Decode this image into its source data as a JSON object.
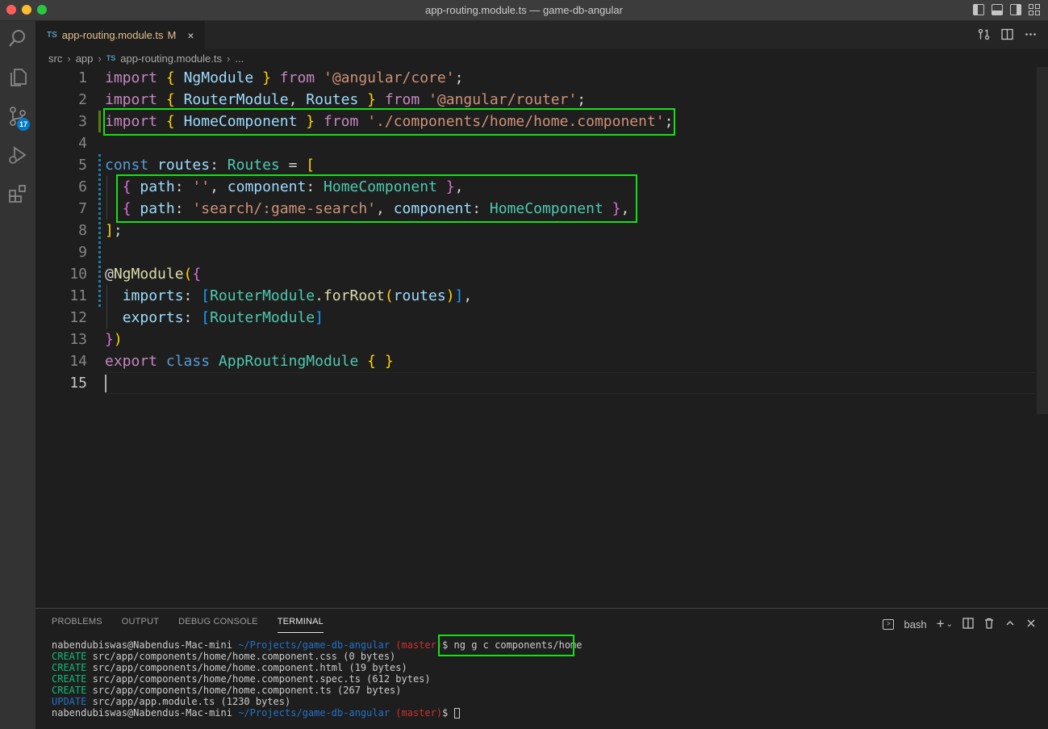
{
  "window": {
    "title": "app-routing.module.ts — game-db-angular"
  },
  "activity_bar": {
    "items": [
      {
        "name": "explorer-search",
        "icon": "search-icon"
      },
      {
        "name": "explorer",
        "icon": "files-icon"
      },
      {
        "name": "source-control",
        "icon": "source-control-icon",
        "badge": "17"
      },
      {
        "name": "run-debug",
        "icon": "run-debug-icon"
      },
      {
        "name": "extensions",
        "icon": "extensions-icon"
      }
    ]
  },
  "tabs": [
    {
      "badge": "TS",
      "label": "app-routing.module.ts",
      "modified": "M",
      "close": "×"
    }
  ],
  "breadcrumb": {
    "items": [
      "src",
      "app",
      "app-routing.module.ts",
      "..."
    ],
    "ts_badge": "TS"
  },
  "editor": {
    "line_numbers": [
      "1",
      "2",
      "3",
      "4",
      "5",
      "6",
      "7",
      "8",
      "9",
      "10",
      "11",
      "12",
      "13",
      "14",
      "15"
    ],
    "active_line": "15"
  },
  "panel": {
    "tabs": [
      "PROBLEMS",
      "OUTPUT",
      "DEBUG CONSOLE",
      "TERMINAL"
    ],
    "active_tab": "TERMINAL",
    "shell": "bash"
  },
  "terminal": {
    "prompt_user": "nabendubiswas@Nabendus-Mac-mini",
    "prompt_path": "~/Projects/game-db-angular",
    "prompt_branch": "(master)",
    "prompt_symbol": "$",
    "command": "ng g c components/home",
    "output": [
      {
        "kind": "CREATE",
        "text": " src/app/components/home/home.component.css (0 bytes)"
      },
      {
        "kind": "CREATE",
        "text": " src/app/components/home/home.component.html (19 bytes)"
      },
      {
        "kind": "CREATE",
        "text": " src/app/components/home/home.component.spec.ts (612 bytes)"
      },
      {
        "kind": "CREATE",
        "text": " src/app/components/home/home.component.ts (267 bytes)"
      },
      {
        "kind": "UPDATE",
        "text": " src/app/app.module.ts (1230 bytes)"
      }
    ]
  },
  "colors": {
    "highlight_box": "#15e015",
    "accent": "#007acc"
  }
}
